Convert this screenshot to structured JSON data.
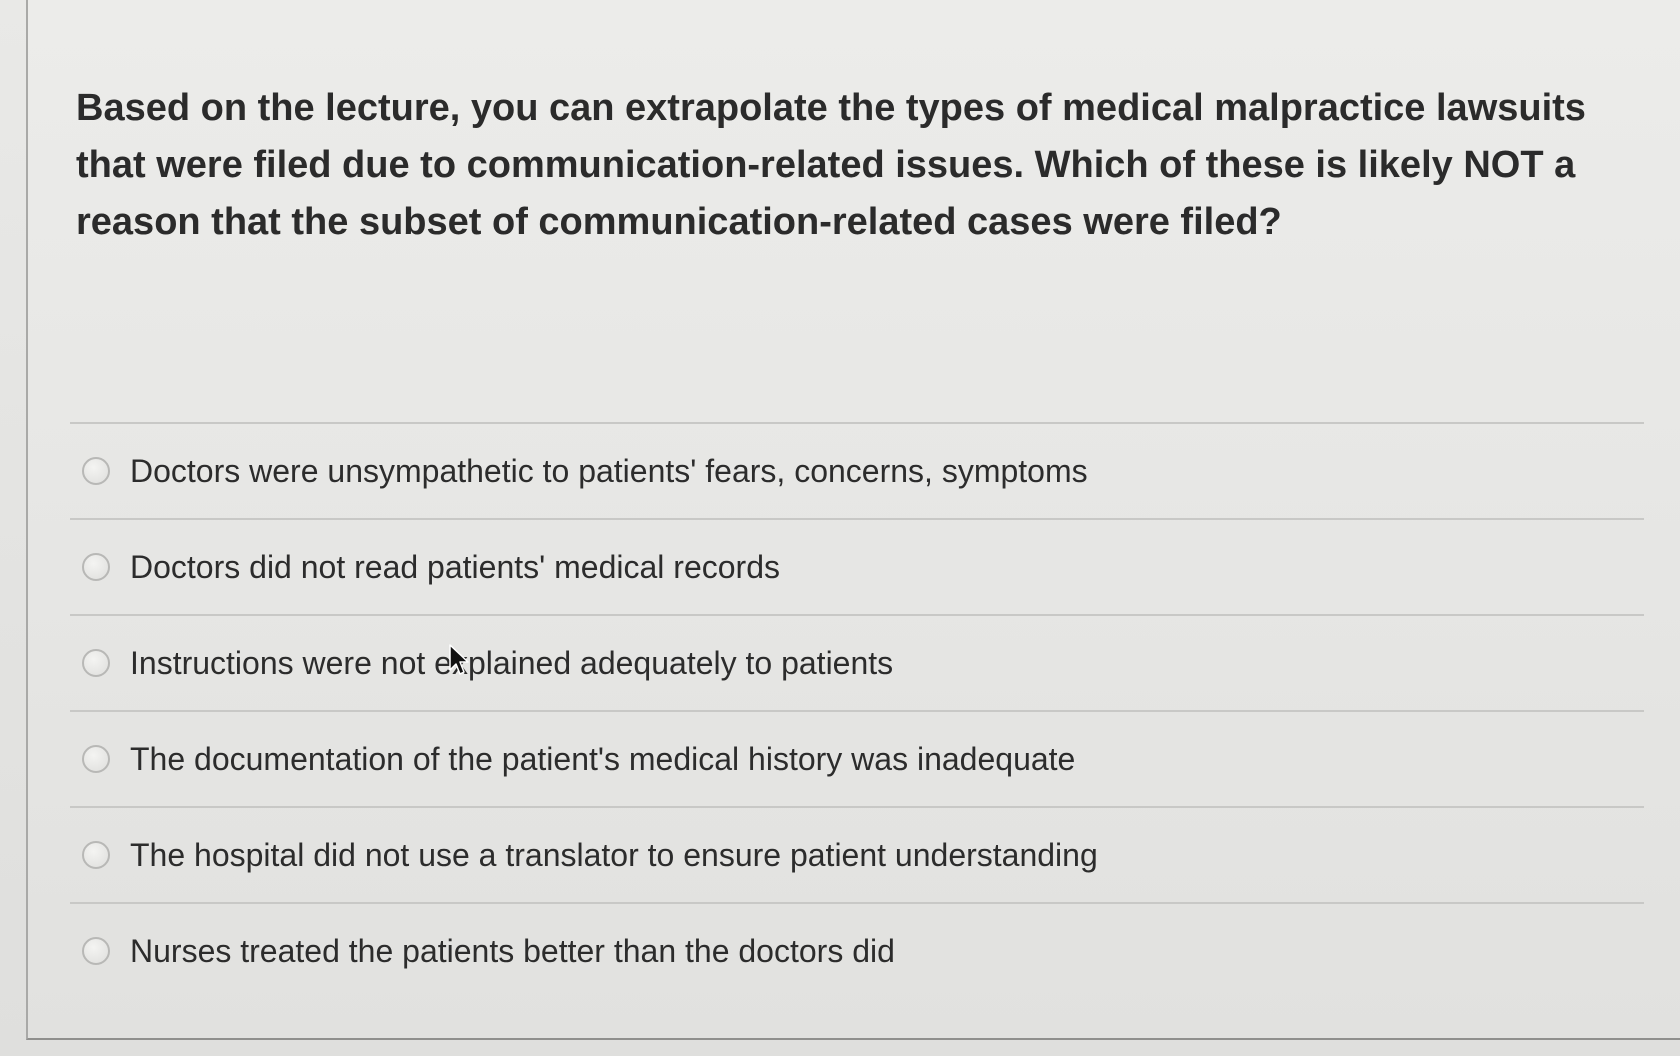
{
  "question": {
    "text": "Based on the lecture, you can extrapolate the types of medical malpractice lawsuits that were filed due to communication-related issues. Which of these is likely NOT a reason that the subset of communication-related cases were filed?"
  },
  "answers": [
    {
      "label": "Doctors were unsympathetic to patients' fears, concerns, symptoms"
    },
    {
      "label": "Doctors did not read patients' medical records"
    },
    {
      "label": "Instructions were not explained adequately to patients"
    },
    {
      "label": "The documentation of the patient's medical history was inadequate"
    },
    {
      "label": "The hospital did not use a translator to ensure patient understanding"
    },
    {
      "label": "Nurses treated the patients better than the doctors did"
    }
  ],
  "icons": {
    "radio": "radio-unselected-icon",
    "cursor": "mouse-pointer-icon"
  }
}
